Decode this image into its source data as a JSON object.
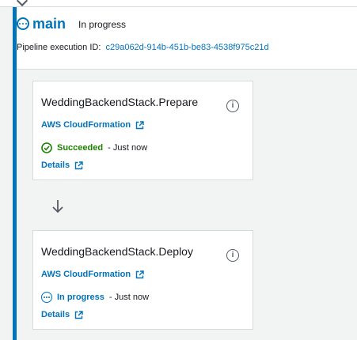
{
  "stage": {
    "name": "main",
    "status": "In progress",
    "execution_label": "Pipeline execution ID:",
    "execution_id": "c29a062d-914b-451b-be83-4538f975c21d"
  },
  "actions": [
    {
      "title": "WeddingBackendStack.Prepare",
      "provider": "AWS CloudFormation",
      "status": "Succeeded",
      "time": "- Just now",
      "details": "Details"
    },
    {
      "title": "WeddingBackendStack.Deploy",
      "provider": "AWS CloudFormation",
      "status": "In progress",
      "time": "- Just now",
      "details": "Details"
    }
  ],
  "icons": {
    "stage_status": "in-progress-icon",
    "info": "info-icon",
    "external_link": "external-link-icon",
    "succeeded": "check-circle-icon",
    "in_progress": "in-progress-icon",
    "transition": "arrow-down-icon"
  },
  "colors": {
    "accent": "#0073bb",
    "success": "#1d8102",
    "text": "#16191f",
    "background": "#f2f3f3"
  }
}
